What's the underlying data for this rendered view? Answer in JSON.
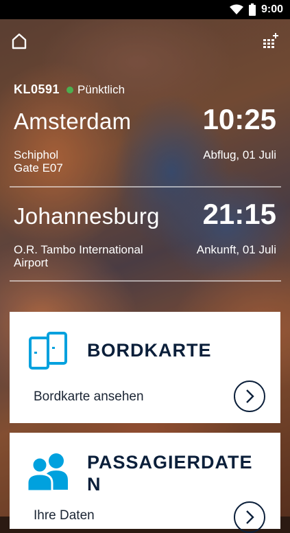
{
  "status_bar": {
    "time": "9:00"
  },
  "flight": {
    "number": "KL0591",
    "status": "Pünktlich",
    "status_color": "#4caf50"
  },
  "departure": {
    "city": "Amsterdam",
    "time": "10:25",
    "airport_line1": "Schiphol",
    "airport_line2": "Gate E07",
    "info": "Abflug, 01 Juli"
  },
  "arrival": {
    "city": "Johannesburg",
    "time": "21:15",
    "airport_line1": "O.R. Tambo International",
    "airport_line2": "Airport",
    "info": "Ankunft, 01 Juli"
  },
  "boarding_card": {
    "title": "BORDKARTE",
    "subtitle": "Bordkarte ansehen",
    "icon": "boarding-pass-icon"
  },
  "passenger_card": {
    "title_line1": "PASSAGIERDATE",
    "title_line2": "N",
    "subtitle": "Ihre Daten",
    "icon": "passengers-icon"
  },
  "colors": {
    "accent_blue": "#00a1de",
    "navy": "#0b1f3a"
  }
}
